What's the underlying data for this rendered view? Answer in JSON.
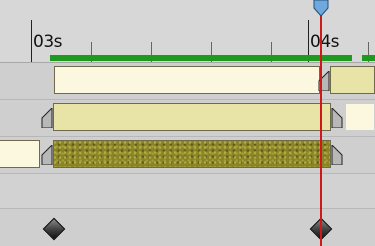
{
  "ruler": {
    "labels": [
      "03s",
      "04s"
    ]
  },
  "colors": {
    "work_area": "#1f9a1f",
    "playhead": "#d01818",
    "playhead_head": "#6fa8dc"
  },
  "tracks": [
    {
      "bar_style": "pale"
    },
    {
      "bar_style": "yellow"
    },
    {
      "bar_style": "textured"
    },
    {
      "bar_style": "empty"
    },
    {
      "bar_style": "keyframes"
    }
  ]
}
